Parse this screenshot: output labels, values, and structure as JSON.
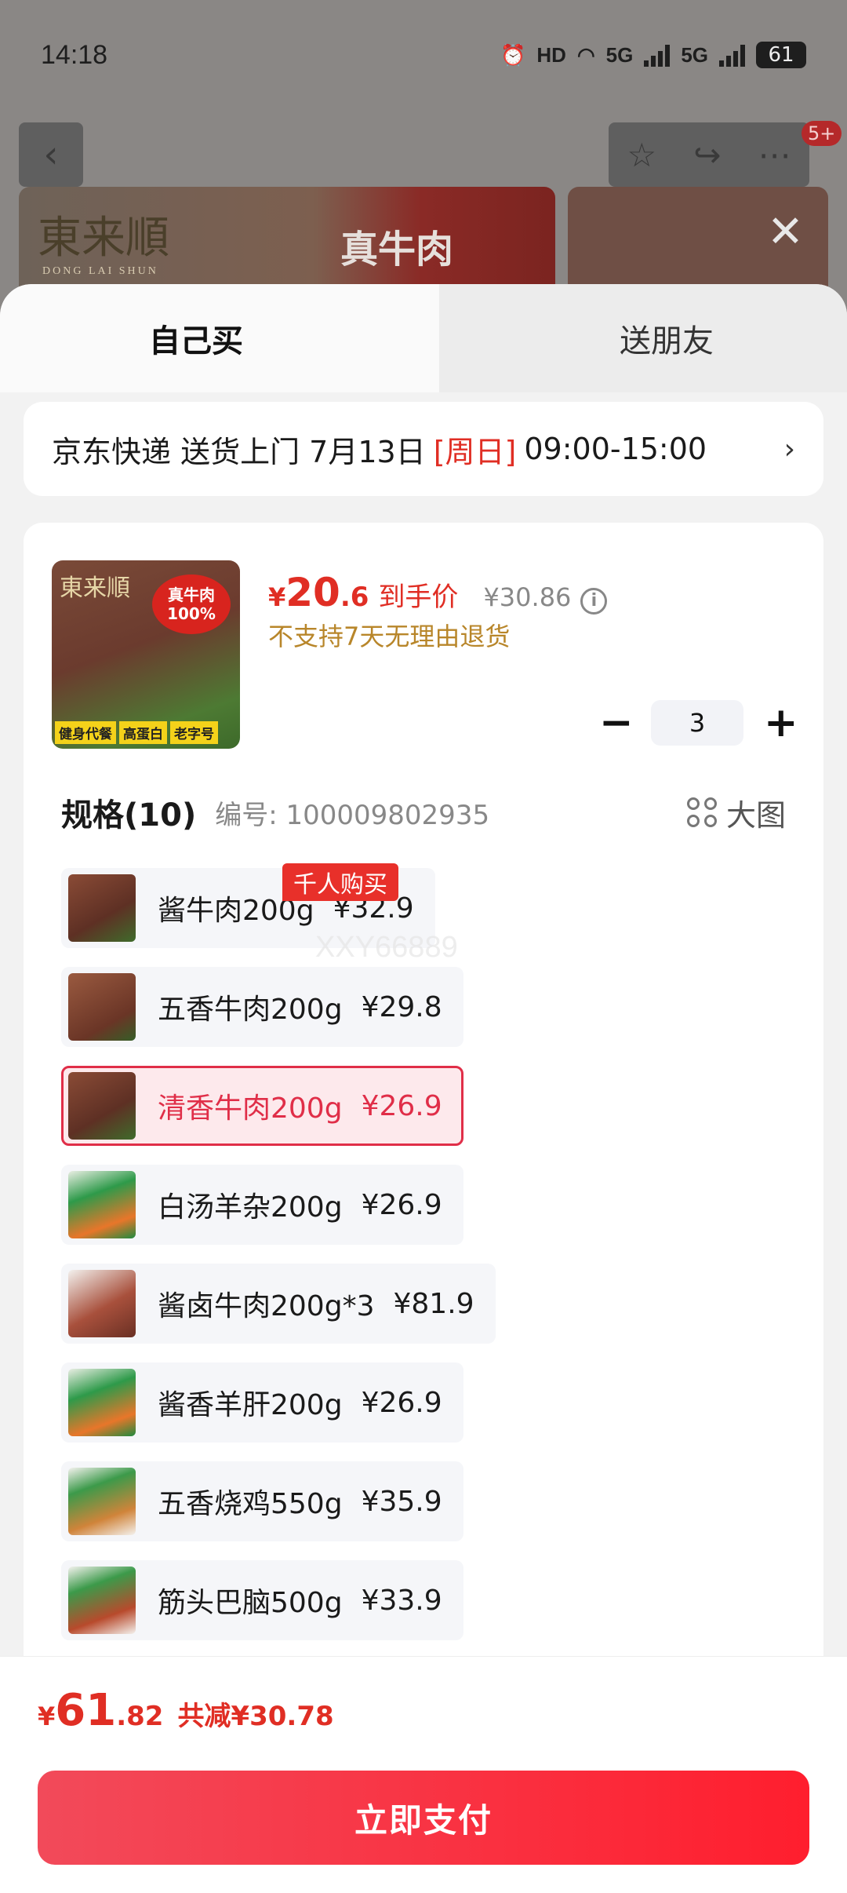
{
  "status_bar": {
    "time": "14:18",
    "battery": "61",
    "network_labels": [
      "HD",
      "5G",
      "5G"
    ]
  },
  "nav": {
    "back_icon": "chevron-left-icon",
    "badge": "5+"
  },
  "banner": {
    "brand": "東来順",
    "brand_sub": "DONG LAI SHUN",
    "tag": "真牛肉"
  },
  "tabs": {
    "self": "自己买",
    "friend": "送朋友"
  },
  "delivery": {
    "text": "京东快递 送货上门 7月13日",
    "weekday": "[周日]",
    "time_window": "09:00-15:00",
    "arrow": "›"
  },
  "product": {
    "image_brand": "東来順",
    "image_tag_line1": "真牛肉",
    "image_tag_line2": "100%",
    "image_badges": [
      "健身代餐",
      "高蛋白",
      "老字号"
    ],
    "price_currency": "¥",
    "price_int": "20",
    "price_dec": ".6",
    "price_label": "到手价",
    "original_price": "¥30.86",
    "return_policy": "不支持7天无理由退货",
    "quantity": "3",
    "minus": "−",
    "plus": "+"
  },
  "spec": {
    "title": "规格(10)",
    "number": "编号: 100009802935",
    "big_pic": "大图",
    "hot_tag": "千人购买",
    "watermark": "XXY66889",
    "items": [
      {
        "name": "酱牛肉200g",
        "price": "¥32.9",
        "selected": false
      },
      {
        "name": "五香牛肉200g",
        "price": "¥29.8",
        "selected": false
      },
      {
        "name": "清香牛肉200g",
        "price": "¥26.9",
        "selected": true
      },
      {
        "name": "白汤羊杂200g",
        "price": "¥26.9",
        "selected": false
      },
      {
        "name": "酱卤牛肉200g*3",
        "price": "¥81.9",
        "selected": false
      },
      {
        "name": "酱香羊肝200g",
        "price": "¥26.9",
        "selected": false
      },
      {
        "name": "五香烧鸡550g",
        "price": "¥35.9",
        "selected": false
      },
      {
        "name": "筋头巴脑500g",
        "price": "¥33.9",
        "selected": false
      }
    ]
  },
  "footer": {
    "currency": "¥",
    "total_int": "61",
    "total_dec": ".82",
    "savings": "共减¥30.78",
    "pay_label": "立即支付"
  },
  "colors": {
    "accent": "#e02e24",
    "selected_border": "#e02e48",
    "pay_button": "#ff1e2e",
    "return_policy": "#b8862a"
  }
}
